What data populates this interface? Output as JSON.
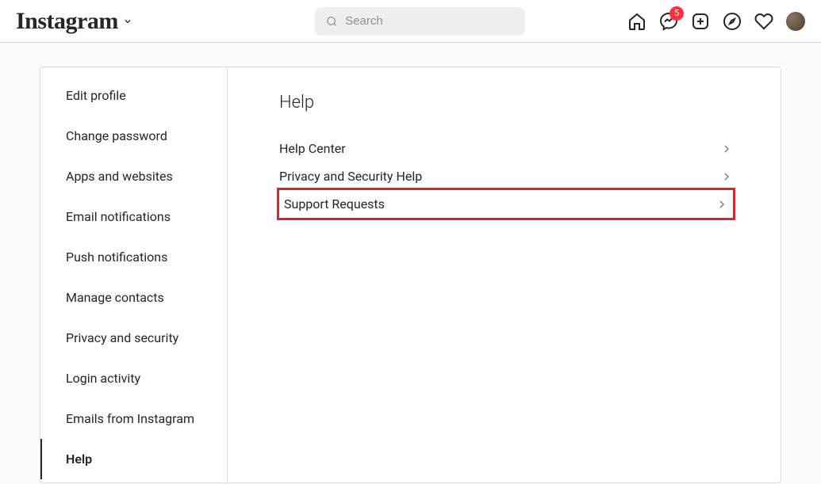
{
  "header": {
    "logo": "Instagram",
    "search_placeholder": "Search",
    "badge_count": "5"
  },
  "sidebar": {
    "items": [
      {
        "label": "Edit profile",
        "active": false
      },
      {
        "label": "Change password",
        "active": false
      },
      {
        "label": "Apps and websites",
        "active": false
      },
      {
        "label": "Email notifications",
        "active": false
      },
      {
        "label": "Push notifications",
        "active": false
      },
      {
        "label": "Manage contacts",
        "active": false
      },
      {
        "label": "Privacy and security",
        "active": false
      },
      {
        "label": "Login activity",
        "active": false
      },
      {
        "label": "Emails from Instagram",
        "active": false
      },
      {
        "label": "Help",
        "active": true
      }
    ]
  },
  "main": {
    "title": "Help",
    "items": [
      {
        "label": "Help Center",
        "highlighted": false
      },
      {
        "label": "Privacy and Security Help",
        "highlighted": false
      },
      {
        "label": "Support Requests",
        "highlighted": true
      }
    ]
  }
}
